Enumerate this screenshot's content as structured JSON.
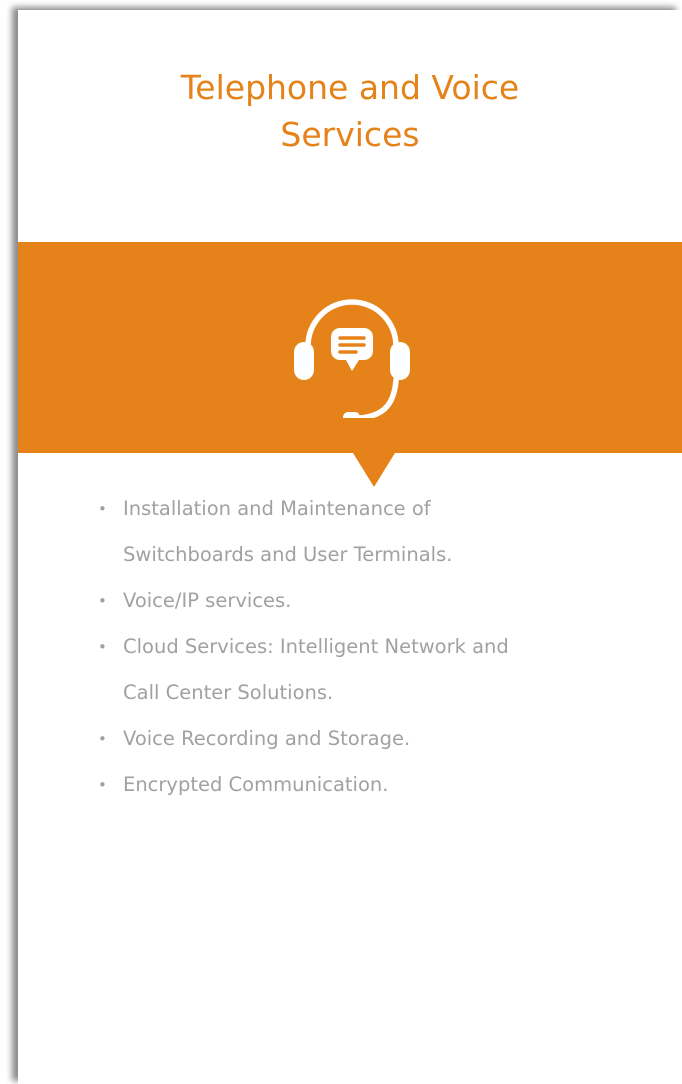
{
  "card": {
    "title_lines": [
      "Telephone and Voice",
      "Services"
    ]
  },
  "icon": {
    "name": "headset-icon",
    "color": "#ffffff"
  },
  "colors": {
    "accent": "#e5831a",
    "text": "#a1a1a1",
    "background": "#ffffff"
  },
  "list": {
    "bullet": "•",
    "items": [
      {
        "lines": [
          "Installation and Maintenance of",
          "Switchboards and User Terminals."
        ]
      },
      {
        "lines": [
          "Voice/IP services."
        ]
      },
      {
        "lines": [
          "Cloud Services: Intelligent Network and",
          "Call Center Solutions."
        ]
      },
      {
        "lines": [
          "Voice Recording and Storage."
        ]
      },
      {
        "lines": [
          "Encrypted Communication."
        ]
      }
    ]
  }
}
